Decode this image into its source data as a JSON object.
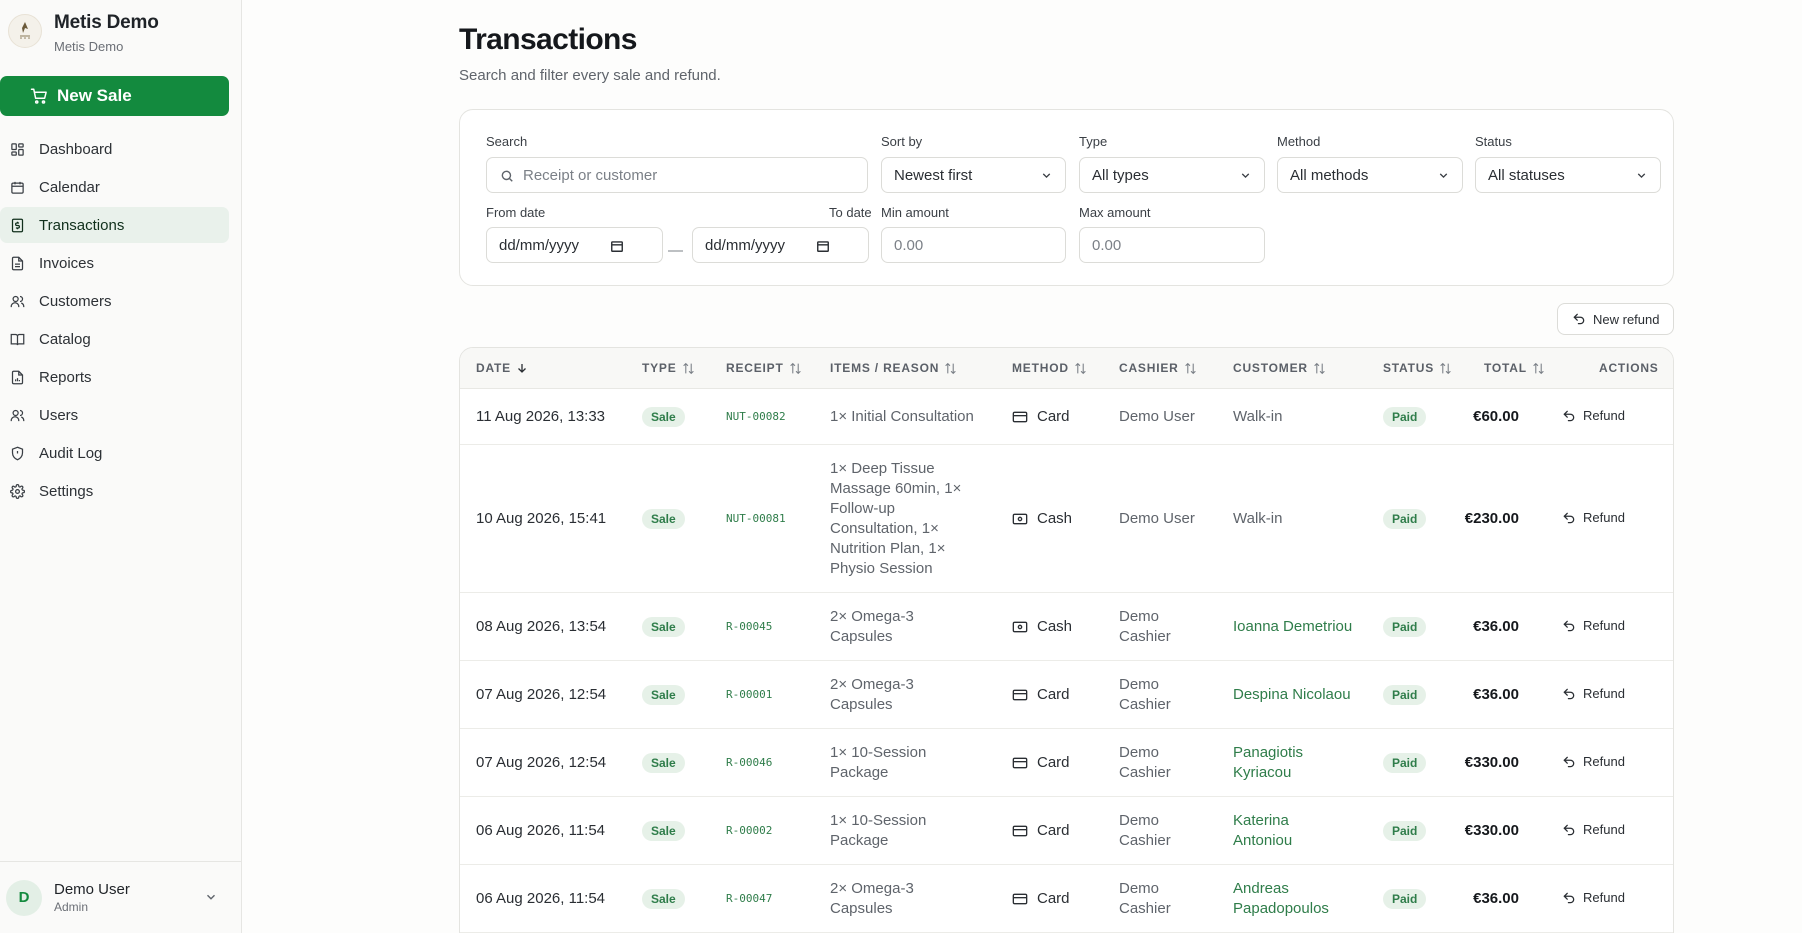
{
  "brand": {
    "name": "Metis Demo",
    "subtitle": "Metis Demo"
  },
  "new_sale_label": "New Sale",
  "nav": [
    {
      "label": "Dashboard",
      "icon": "dashboard-icon"
    },
    {
      "label": "Calendar",
      "icon": "calendar-icon"
    },
    {
      "label": "Transactions",
      "icon": "transactions-icon",
      "active": true
    },
    {
      "label": "Invoices",
      "icon": "invoice-icon"
    },
    {
      "label": "Customers",
      "icon": "users-icon"
    },
    {
      "label": "Catalog",
      "icon": "book-icon"
    },
    {
      "label": "Reports",
      "icon": "report-icon"
    },
    {
      "label": "Users",
      "icon": "users-icon"
    },
    {
      "label": "Audit Log",
      "icon": "shield-icon"
    },
    {
      "label": "Settings",
      "icon": "gear-icon"
    }
  ],
  "user": {
    "initial": "D",
    "name": "Demo User",
    "role": "Admin"
  },
  "page": {
    "title": "Transactions",
    "subtitle": "Search and filter every sale and refund."
  },
  "filters": {
    "search_label": "Search",
    "search_placeholder": "Receipt or customer",
    "sort_label": "Sort by",
    "sort_value": "Newest first",
    "type_label": "Type",
    "type_value": "All types",
    "method_label": "Method",
    "method_value": "All methods",
    "status_label": "Status",
    "status_value": "All statuses",
    "from_label": "From date",
    "to_label": "To date",
    "date_placeholder": "dd/mm/yyyy",
    "date_separator": "—",
    "min_label": "Min amount",
    "max_label": "Max amount",
    "amount_placeholder": "0.00"
  },
  "new_refund_label": "New refund",
  "table": {
    "headers": {
      "date": "DATE",
      "type": "TYPE",
      "receipt": "RECEIPT",
      "items": "ITEMS / REASON",
      "method": "METHOD",
      "cashier": "CASHIER",
      "customer": "CUSTOMER",
      "status": "STATUS",
      "total": "TOTAL",
      "actions": "ACTIONS"
    },
    "action_label": "Refund",
    "rows": [
      {
        "date": "11 Aug 2026, 13:33",
        "type": "Sale",
        "receipt": "NUT-00082",
        "items": [
          "1× Initial Consultation"
        ],
        "method": "Card",
        "cashier": [
          "Demo User"
        ],
        "customer": [
          "Walk-in"
        ],
        "customer_link": false,
        "status": "Paid",
        "total": "€60.00"
      },
      {
        "date": "10 Aug 2026, 15:41",
        "type": "Sale",
        "receipt": "NUT-00081",
        "items": [
          "1× Deep Tissue",
          "Massage 60min, 1×",
          "Follow-up",
          "Consultation, 1×",
          "Nutrition Plan, 1×",
          "Physio Session"
        ],
        "method": "Cash",
        "cashier": [
          "Demo User"
        ],
        "customer": [
          "Walk-in"
        ],
        "customer_link": false,
        "status": "Paid",
        "total": "€230.00"
      },
      {
        "date": "08 Aug 2026, 13:54",
        "type": "Sale",
        "receipt": "R-00045",
        "items": [
          "2× Omega-3",
          "Capsules"
        ],
        "method": "Cash",
        "cashier": [
          "Demo",
          "Cashier"
        ],
        "customer": [
          "Ioanna Demetriou"
        ],
        "customer_link": true,
        "status": "Paid",
        "total": "€36.00"
      },
      {
        "date": "07 Aug 2026, 12:54",
        "type": "Sale",
        "receipt": "R-00001",
        "items": [
          "2× Omega-3",
          "Capsules"
        ],
        "method": "Card",
        "cashier": [
          "Demo",
          "Cashier"
        ],
        "customer": [
          "Despina Nicolaou"
        ],
        "customer_link": true,
        "status": "Paid",
        "total": "€36.00"
      },
      {
        "date": "07 Aug 2026, 12:54",
        "type": "Sale",
        "receipt": "R-00046",
        "items": [
          "1× 10-Session",
          "Package"
        ],
        "method": "Card",
        "cashier": [
          "Demo",
          "Cashier"
        ],
        "customer": [
          "Panagiotis",
          "Kyriacou"
        ],
        "customer_link": true,
        "status": "Paid",
        "total": "€330.00"
      },
      {
        "date": "06 Aug 2026, 11:54",
        "type": "Sale",
        "receipt": "R-00002",
        "items": [
          "1× 10-Session",
          "Package"
        ],
        "method": "Card",
        "cashier": [
          "Demo",
          "Cashier"
        ],
        "customer": [
          "Katerina",
          "Antoniou"
        ],
        "customer_link": true,
        "status": "Paid",
        "total": "€330.00"
      },
      {
        "date": "06 Aug 2026, 11:54",
        "type": "Sale",
        "receipt": "R-00047",
        "items": [
          "2× Omega-3",
          "Capsules"
        ],
        "method": "Card",
        "cashier": [
          "Demo",
          "Cashier"
        ],
        "customer": [
          "Andreas",
          "Papadopoulos"
        ],
        "customer_link": true,
        "status": "Paid",
        "total": "€36.00"
      }
    ]
  }
}
